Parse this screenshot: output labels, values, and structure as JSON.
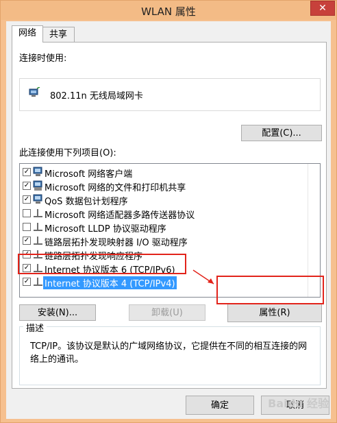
{
  "window": {
    "title": "WLAN 属性",
    "close_glyph": "✕"
  },
  "tabs": [
    {
      "label": "网络",
      "active": true
    },
    {
      "label": "共享",
      "active": false
    }
  ],
  "connect_using": {
    "label": "连接时使用:",
    "adapter_name": "802.11n 无线局域网卡",
    "configure_button": "配置(C)..."
  },
  "items_section": {
    "label": "此连接使用下列项目(O):",
    "items": [
      {
        "checked": true,
        "icon": "network-client-icon",
        "label": "Microsoft 网络客户端",
        "selected": false
      },
      {
        "checked": true,
        "icon": "file-printer-sharing-icon",
        "label": "Microsoft 网络的文件和打印机共享",
        "selected": false
      },
      {
        "checked": true,
        "icon": "qos-scheduler-icon",
        "label": "QoS 数据包计划程序",
        "selected": false
      },
      {
        "checked": false,
        "icon": "protocol-icon",
        "label": "Microsoft 网络适配器多路传送器协议",
        "selected": false
      },
      {
        "checked": false,
        "icon": "protocol-icon",
        "label": "Microsoft LLDP 协议驱动程序",
        "selected": false
      },
      {
        "checked": true,
        "icon": "protocol-icon",
        "label": "链路层拓扑发现映射器 I/O 驱动程序",
        "selected": false
      },
      {
        "checked": true,
        "icon": "protocol-icon",
        "label": "链路层拓扑发现响应程序",
        "selected": false
      },
      {
        "checked": true,
        "icon": "protocol-icon",
        "label": "Internet 协议版本 6 (TCP/IPv6)",
        "selected": false
      },
      {
        "checked": true,
        "icon": "protocol-icon",
        "label": "Internet 协议版本 4 (TCP/IPv4)",
        "selected": true
      }
    ],
    "install_button": "安装(N)...",
    "uninstall_button": "卸载(U)",
    "properties_button": "属性(R)"
  },
  "description": {
    "legend": "描述",
    "text": "TCP/IP。该协议是默认的广域网络协议，它提供在不同的相互连接的网络上的通讯。"
  },
  "footer": {
    "ok_button": "确定",
    "cancel_button": "取消"
  },
  "watermark": "Baidu 经验",
  "colors": {
    "annotation_red": "#e2231a",
    "selection_blue": "#3399ff",
    "title_bar": "#f3bb86"
  }
}
